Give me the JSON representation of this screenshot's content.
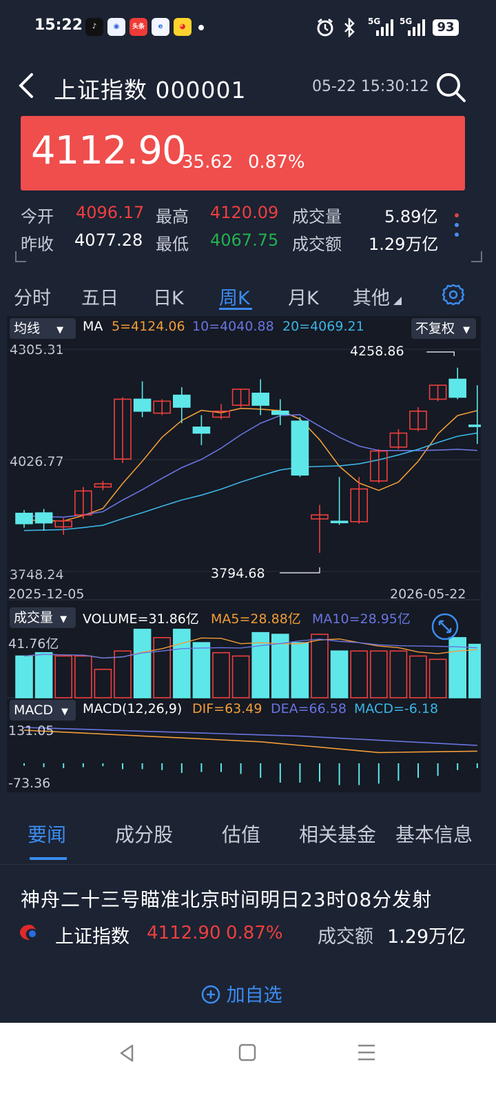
{
  "status_bar": {
    "time": "15:22",
    "apps": [
      "tiktok-icon",
      "baidu-icon",
      "toutiao-icon",
      "browser-icon",
      "weibo-icon"
    ],
    "toutiao_text": "头条",
    "signal_1": "5G",
    "signal_2": "5G",
    "battery": "93"
  },
  "header": {
    "title": "上证指数 000001",
    "datetime": "05-22 15:30:12"
  },
  "quote": {
    "price": "4112.90",
    "change": "35.62",
    "change_pct": "0.87%",
    "open_label": "今开",
    "open": "4096.17",
    "high_label": "最高",
    "high": "4120.09",
    "volume_label": "成交量",
    "volume": "5.89亿",
    "prev_close_label": "昨收",
    "prev_close": "4077.28",
    "low_label": "最低",
    "low": "4067.75",
    "amount_label": "成交额",
    "amount": "1.29万亿"
  },
  "chart_tabs": [
    "分时",
    "五日",
    "日K",
    "周K",
    "月K",
    "其他"
  ],
  "chart_tab_active": "周K",
  "kline": {
    "indicator_btn": "均线",
    "ma_label": "MA",
    "ma5": "5=4124.06",
    "ma10": "10=4040.88",
    "ma20": "20=4069.21",
    "adjust_btn": "不复权",
    "y_top": "4305.31",
    "y_mid": "4026.77",
    "y_bottom": "3748.24",
    "max_label": "4258.86",
    "min_label": "3794.68",
    "date_start": "2025-12-05",
    "date_end": "2026-05-22"
  },
  "volume_panel": {
    "btn": "成交量",
    "volume": "VOLUME=31.86亿",
    "ma5": "MA5=28.88亿",
    "ma10": "MA10=28.95亿",
    "y_top": "41.76亿"
  },
  "macd_panel": {
    "btn": "MACD",
    "params": "MACD(12,26,9)",
    "dif": "DIF=63.49",
    "dea": "DEA=66.58",
    "macd": "MACD=-6.18",
    "y_top": "131.05",
    "y_bottom": "-73.36"
  },
  "colors": {
    "up": "#ef3f3e",
    "down": "#5ee7e9",
    "ma5": "#f39c37",
    "ma10": "#6a74e0",
    "ma20": "#3cb4e6",
    "accent": "#3b8cf0"
  },
  "chart_data": {
    "type": "candlestick",
    "dates": [
      "2025-12-05",
      "2026-05-22"
    ],
    "candles": [
      {
        "o": 3894,
        "c": 3868,
        "h": 3902,
        "l": 3858
      },
      {
        "o": 3895,
        "c": 3870,
        "h": 3905,
        "l": 3850
      },
      {
        "o": 3860,
        "c": 3875,
        "h": 3882,
        "l": 3840
      },
      {
        "o": 3890,
        "c": 3950,
        "h": 3960,
        "l": 3880
      },
      {
        "o": 3960,
        "c": 3968,
        "h": 3975,
        "l": 3952
      },
      {
        "o": 4030,
        "c": 4180,
        "h": 4185,
        "l": 4020
      },
      {
        "o": 4180,
        "c": 4150,
        "h": 4225,
        "l": 4135
      },
      {
        "o": 4145,
        "c": 4175,
        "h": 4180,
        "l": 4140
      },
      {
        "o": 4190,
        "c": 4160,
        "h": 4210,
        "l": 4120
      },
      {
        "o": 4110,
        "c": 4095,
        "h": 4140,
        "l": 4065
      },
      {
        "o": 4135,
        "c": 4150,
        "h": 4168,
        "l": 4130
      },
      {
        "o": 4165,
        "c": 4205,
        "h": 4205,
        "l": 4160
      },
      {
        "o": 4195,
        "c": 4165,
        "h": 4230,
        "l": 4140
      },
      {
        "o": 4150,
        "c": 4142,
        "h": 4180,
        "l": 4115
      },
      {
        "o": 4125,
        "c": 3990,
        "h": 4135,
        "l": 3985
      },
      {
        "o": 3880,
        "c": 3890,
        "h": 3915,
        "l": 3795
      },
      {
        "o": 3874,
        "c": 3872,
        "h": 3985,
        "l": 3865
      },
      {
        "o": 3873,
        "c": 3955,
        "h": 3985,
        "l": 3868
      },
      {
        "o": 3975,
        "c": 4050,
        "h": 4055,
        "l": 3970
      },
      {
        "o": 4060,
        "c": 4095,
        "h": 4105,
        "l": 4055
      },
      {
        "o": 4105,
        "c": 4150,
        "h": 4160,
        "l": 4100
      },
      {
        "o": 4180,
        "c": 4215,
        "h": 4215,
        "l": 4175
      },
      {
        "o": 4230,
        "c": 4185,
        "h": 4259,
        "l": 4180
      },
      {
        "o": 4115,
        "c": 4112.9,
        "h": 4215,
        "l": 4068
      }
    ],
    "volumes": [
      25,
      27,
      25,
      25,
      17,
      28,
      41,
      36,
      41,
      33,
      27,
      25,
      39,
      38,
      33,
      38,
      28,
      28,
      28,
      28,
      25,
      23,
      36,
      32
    ],
    "macd_hist": [
      5,
      8,
      10,
      8,
      6,
      12,
      12,
      14,
      20,
      18,
      18,
      22,
      30,
      40,
      40,
      38,
      45,
      45,
      42,
      36,
      30,
      26,
      14,
      10
    ],
    "ylim": [
      3748.24,
      4305.31
    ]
  },
  "bottom_tabs": [
    "要闻",
    "成分股",
    "估值",
    "相关基金",
    "基本信息"
  ],
  "bottom_tab_active": "要闻",
  "news_headline": "神舟二十三号瞄准北京时间明日23时08分发射",
  "ticker": {
    "name": "上证指数",
    "price": "4112.90",
    "pct": "0.87%",
    "amount_label": "成交额",
    "amount": "1.29万亿"
  },
  "add_favorite": "加自选"
}
